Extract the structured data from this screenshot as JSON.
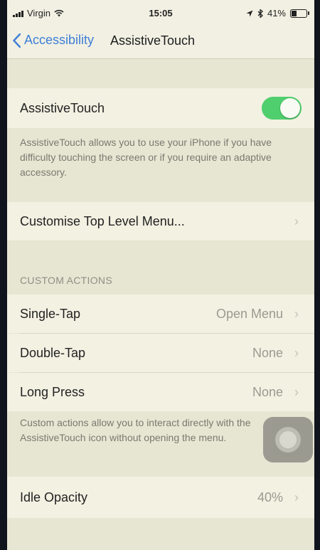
{
  "status_bar": {
    "carrier": "Virgin",
    "time": "15:05",
    "battery_percent": "41%",
    "battery_level": 0.41
  },
  "nav": {
    "back_label": "Accessibility",
    "title": "AssistiveTouch"
  },
  "assistive_touch": {
    "label": "AssistiveTouch",
    "enabled": true,
    "toggle_color": "#4fcf6d",
    "description": "AssistiveTouch allows you to use your iPhone if you have difficulty touching the screen or if you require an adaptive accessory."
  },
  "customise": {
    "label": "Customise Top Level Menu..."
  },
  "custom_actions": {
    "header": "CUSTOM ACTIONS",
    "items": [
      {
        "label": "Single-Tap",
        "value": "Open Menu"
      },
      {
        "label": "Double-Tap",
        "value": "None"
      },
      {
        "label": "Long Press",
        "value": "None"
      }
    ],
    "footer": "Custom actions allow you to interact directly with the AssistiveTouch icon without opening the menu."
  },
  "idle_opacity": {
    "label": "Idle Opacity",
    "value": "40%"
  },
  "icons": {
    "chevron": "›",
    "back": "chevron-left-icon"
  },
  "accent_color": "#3f7fd6"
}
